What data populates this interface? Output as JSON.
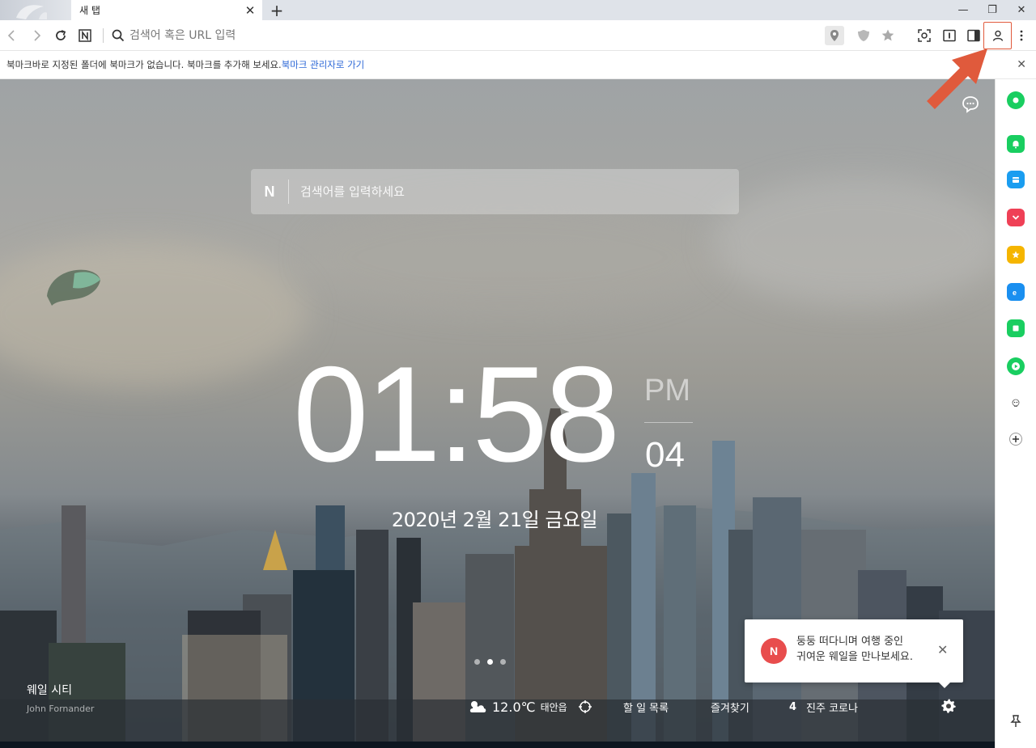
{
  "browser": {
    "tab_title": "새 탭",
    "tab_close": "✕",
    "new_tab": "+",
    "window_controls": {
      "minimize": "—",
      "restore": "❐",
      "close": "✕"
    }
  },
  "toolbar": {
    "address_placeholder": "검색어 혹은 URL 입력",
    "address_value": "",
    "icons": [
      "back-icon",
      "forward-icon",
      "reload-icon",
      "naver-n-icon",
      "search-icon",
      "location-icon",
      "shield-icon",
      "star-icon",
      "capture-icon",
      "reader-icon",
      "sidebar-toggle-icon",
      "profile-icon",
      "menu-icon"
    ]
  },
  "bookmark_bar": {
    "message": "북마크바로 지정된 폴더에 북마크가 없습니다. 북마크를 추가해 보세요.",
    "link": "북마크 관리자로 가기",
    "close": "✕"
  },
  "new_tab_page": {
    "search": {
      "logo": "N",
      "placeholder": "검색어를 입력하세요"
    },
    "clock": {
      "time": "01:58",
      "ampm": "PM",
      "seconds": "04",
      "date": "2020년 2월 21일 금요일"
    },
    "carousel": {
      "count": 3,
      "active_index": 1
    },
    "photo_credit": {
      "title": "웨일 시티",
      "author": "John Fornander"
    },
    "bottom_bar": {
      "temperature": "12.0℃",
      "city": "태안읍",
      "todo": "할 일 목록",
      "favorites": "즐겨찾기",
      "news_rank": "4",
      "news_headline": "진주 코로나"
    },
    "toast": {
      "badge": "N",
      "line1": "둥둥 떠다니며 여행 중인",
      "line2": "귀여운 웨일을 만나보세요.",
      "close": "✕"
    }
  },
  "sidebar": {
    "items": [
      {
        "name": "green-circle-app-icon",
        "color": "#19ce60"
      },
      {
        "name": "bell-app-icon",
        "color": "#19ce60"
      },
      {
        "name": "wallet-app-icon",
        "color": "#1a9df0"
      },
      {
        "name": "pocket-app-icon",
        "color": "#ef4056"
      },
      {
        "name": "star-app-icon",
        "color": "#f5b500"
      },
      {
        "name": "translate-app-icon",
        "color": "#1a8ff0"
      },
      {
        "name": "square-app-icon",
        "color": "#19ce60"
      },
      {
        "name": "play-app-icon",
        "color": "#19ce60"
      },
      {
        "name": "character-app-icon",
        "color": "#7aa88a"
      },
      {
        "name": "add-app-icon",
        "color": "#333333"
      }
    ]
  },
  "colors": {
    "accent_link": "#2a66d6",
    "annotation": "#e05a3c",
    "naver_green": "#19ce60"
  }
}
